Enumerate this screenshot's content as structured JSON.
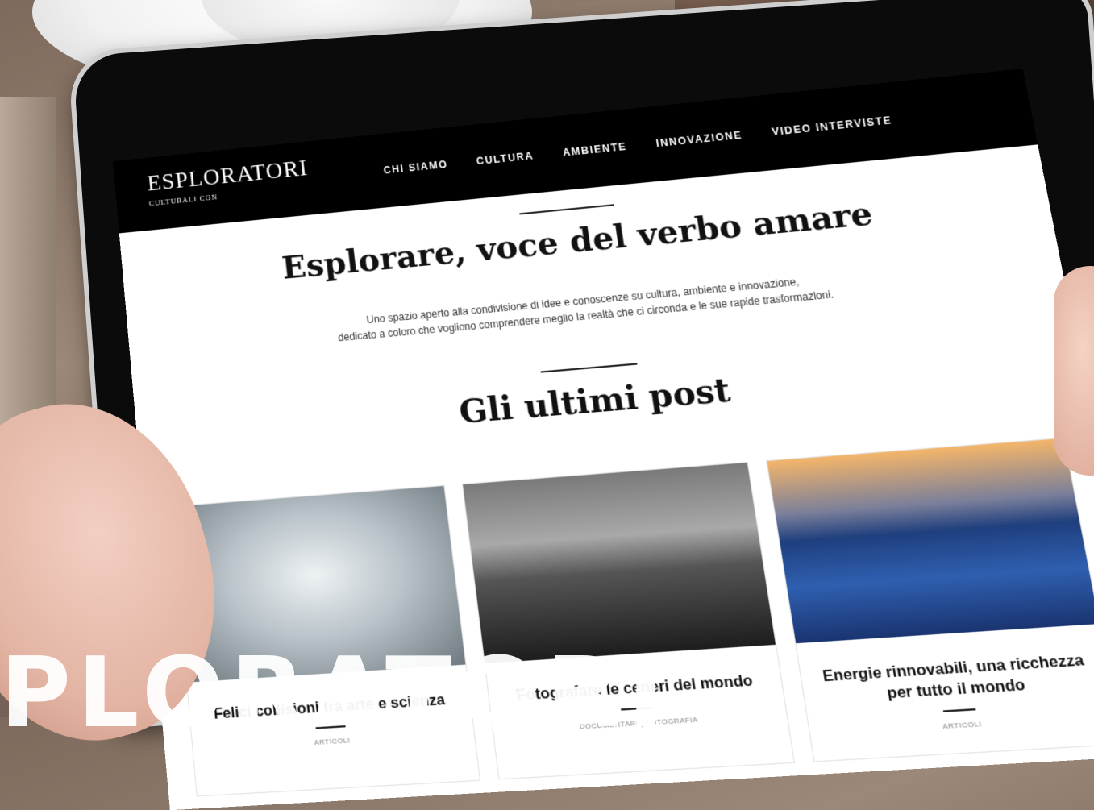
{
  "site": {
    "logo_main": "ESPLORATORI",
    "logo_sub": "CULTURALI CGN"
  },
  "nav": {
    "items": [
      "CHI SIAMO",
      "CULTURA",
      "AMBIENTE",
      "INNOVAZIONE",
      "VIDEO INTERVISTE"
    ]
  },
  "hero": {
    "title": "Esplorare, voce del verbo amare",
    "intro_line1": "Uno spazio aperto alla condivisione di idee e conoscenze su cultura, ambiente e innovazione,",
    "intro_line2": "dedicato a coloro che vogliono comprendere meglio la realtà che ci circonda e le sue rapide trasformazioni."
  },
  "posts": {
    "heading": "Gli ultimi post",
    "items": [
      {
        "title": "Felici collisioni tra arte e scienza",
        "category": "ARTICOLI"
      },
      {
        "title": "Fotografare le ceneri del mondo",
        "category": "DOCUMENTARI | FOTOGRAFIA"
      },
      {
        "title": "Energie rinnovabili, una ricchezza per tutto il mondo",
        "category": "ARTICOLI"
      }
    ]
  },
  "watermark": "PLORATORI"
}
